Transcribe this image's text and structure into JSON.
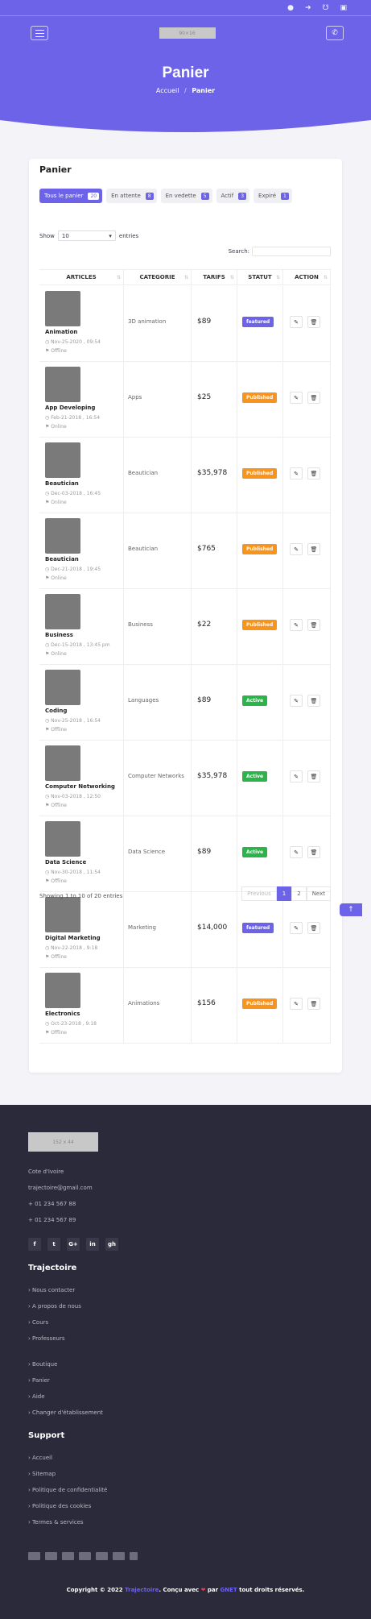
{
  "topbar": {
    "icons": [
      "user-icon",
      "login-icon",
      "cart-icon",
      "bag-icon"
    ]
  },
  "navbar": {
    "logo_text": "90×16"
  },
  "hero": {
    "title": "Panier",
    "breadcrumb_home": "Accueil",
    "breadcrumb_sep": "/",
    "breadcrumb_current": "Panier"
  },
  "card": {
    "title": "Panier"
  },
  "tabs": [
    {
      "label": "Tous le panier",
      "count": "20"
    },
    {
      "label": "En attente",
      "count": "8"
    },
    {
      "label": "En vedette",
      "count": "5"
    },
    {
      "label": "Actif",
      "count": "3"
    },
    {
      "label": "Expiré",
      "count": "1"
    }
  ],
  "table_controls": {
    "show_label": "Show",
    "show_value": "10",
    "entries_label": "entries",
    "search_label": "Search:"
  },
  "table": {
    "headers": [
      "ARTICLES",
      "CATEGORIE",
      "TARIFS",
      "STATUT",
      "ACTION"
    ],
    "rows": [
      {
        "name": "Animation",
        "date": "Nov-25-2020 , 09:54",
        "status_text": "Offline",
        "category": "3D animation",
        "price": "$89",
        "badge": "featured"
      },
      {
        "name": "App Developing",
        "date": "Feb-21-2018 , 16:54",
        "status_text": "Online",
        "category": "Apps",
        "price": "$25",
        "badge": "Published"
      },
      {
        "name": "Beautician",
        "date": "Dec-03-2018 , 16:45",
        "status_text": "Online",
        "category": "Beautician",
        "price": "$35,978",
        "badge": "Published"
      },
      {
        "name": "Beautician",
        "date": "Dec-21-2018 , 19:45",
        "status_text": "Online",
        "category": "Beautician",
        "price": "$765",
        "badge": "Published"
      },
      {
        "name": "Business",
        "date": "Dec-15-2018 , 13:45 pm",
        "status_text": "Online",
        "category": "Business",
        "price": "$22",
        "badge": "Published"
      },
      {
        "name": "Coding",
        "date": "Nov-25-2018 , 16:54",
        "status_text": "Offline",
        "category": "Languages",
        "price": "$89",
        "badge": "Active"
      },
      {
        "name": "Computer Networking",
        "date": "Nov-03-2018 , 12:50",
        "status_text": "Offline",
        "category": "Computer Networks",
        "price": "$35,978",
        "badge": "Active"
      },
      {
        "name": "Data Science",
        "date": "Nov-30-2018 , 11:54",
        "status_text": "Offline",
        "category": "Data Science",
        "price": "$89",
        "badge": "Active"
      },
      {
        "name": "Digital Marketing",
        "date": "Nov-22-2018 , 9:18",
        "status_text": "Offline",
        "category": "Marketing",
        "price": "$14,000",
        "badge": "featured"
      },
      {
        "name": "Electronics",
        "date": "Oct-23-2018 , 9:18",
        "status_text": "Offline",
        "category": "Animations",
        "price": "$156",
        "badge": "Published"
      }
    ]
  },
  "table_footer": {
    "info": "Showing 1 to 10 of 20 entries",
    "prev": "Previous",
    "pages": [
      "1",
      "2"
    ],
    "next": "Next"
  },
  "badge_colors": {
    "featured": "#6c63e8",
    "Published": "#f7941d",
    "Active": "#2cb34a"
  },
  "footer": {
    "logo_text": "152 x 44",
    "country": "Cote d'Ivoire",
    "email": "trajectoire@gmail.com",
    "phone1": "+ 01 234 567 88",
    "phone2": "+ 01 234 567 89",
    "socials": [
      "f",
      "t",
      "G+",
      "in",
      "gh"
    ],
    "section1_title": "Trajectoire",
    "section1_links": [
      "Nous contacter",
      "A propos de nous",
      "Cours",
      "Professeurs"
    ],
    "section2_links": [
      "Boutique",
      "Panier",
      "Aide",
      "Changer d'établissement"
    ],
    "section3_title": "Support",
    "section3_links": [
      "Accueil",
      "Sitemap",
      "Politique de confidentialité",
      "Politique des cookies",
      "Termes & services"
    ],
    "copyright_pre": "Copyright © 2022",
    "brand": "Trajectoire",
    "copyright_mid": ". Conçu avec",
    "copyright_par": "par",
    "author": "GNET",
    "copyright_post": "tout droits réservés."
  },
  "colors": {
    "accent": "#6c63e8",
    "footer_bg": "#2b2a3a"
  }
}
